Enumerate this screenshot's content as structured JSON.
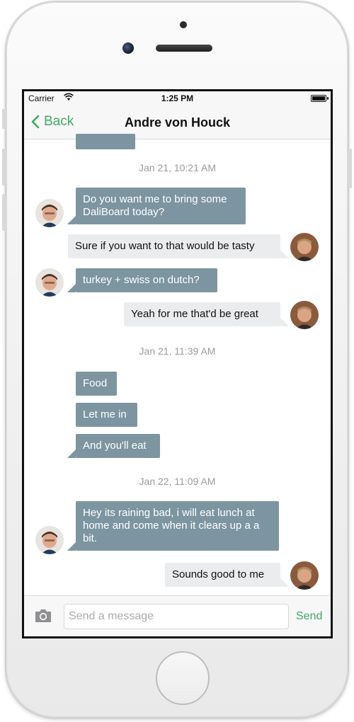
{
  "status_bar": {
    "carrier": "Carrier",
    "time": "1:25 PM"
  },
  "nav": {
    "back_label": "Back",
    "title": "Andre von Houck"
  },
  "timestamps": [
    "Jan 21, 10:21 AM",
    "Jan 21, 11:39 AM",
    "Jan 22, 11:09 AM"
  ],
  "messages": [
    {
      "direction": "incoming",
      "text": "Do you want me to bring some DaliBoard today?"
    },
    {
      "direction": "outgoing",
      "text": "Sure if you want to that would be tasty"
    },
    {
      "direction": "incoming",
      "text": "turkey + swiss on dutch?"
    },
    {
      "direction": "outgoing",
      "text": "Yeah for me that'd be great"
    },
    {
      "direction": "incoming",
      "text": "Food"
    },
    {
      "direction": "incoming",
      "text": "Let me in"
    },
    {
      "direction": "incoming",
      "text": "And you'll eat"
    },
    {
      "direction": "incoming",
      "text": "Hey its raining bad, i will eat lunch at home and come when it clears up a a bit."
    },
    {
      "direction": "outgoing",
      "text": "Sounds good to me"
    }
  ],
  "composer": {
    "placeholder": "Send a message",
    "send_label": "Send"
  },
  "colors": {
    "accent": "#3daa63",
    "incoming_bubble": "#7d95a0",
    "outgoing_bubble": "#eaecee"
  }
}
